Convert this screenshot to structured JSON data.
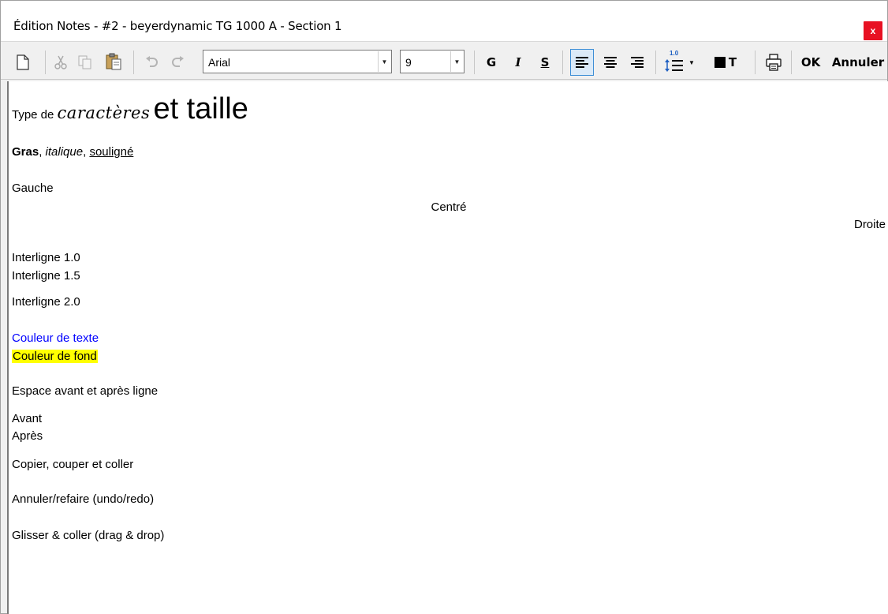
{
  "window": {
    "title": "Édition Notes - #2 - beyerdynamic TG 1000 A  -  Section 1",
    "close_label": "x"
  },
  "toolbar": {
    "font_name": "Arial",
    "font_size": "9",
    "bold_label": "G",
    "italic_label": "I",
    "underline_label": "S",
    "spacing_badge": "1.0",
    "color_label": "T",
    "ok_label": "OK",
    "cancel_label": "Annuler"
  },
  "editor": {
    "line1_small": "Type de",
    "line1_decor": "caractères",
    "line1_big": "et taille",
    "line2_bold": "Gras",
    "line2_sep1": ", ",
    "line2_italic": "italique",
    "line2_sep2": ", ",
    "line2_underline": "souligné",
    "left": "Gauche",
    "center": "Centré",
    "right": "Droite",
    "spacing1": "Interligne 1.0",
    "spacing15": "Interligne 1.5",
    "spacing2": "Interligne 2.0",
    "text_color": "Couleur de texte",
    "bg_color": "Couleur de fond",
    "space_title": "Espace avant et après ligne",
    "before": "Avant",
    "after": "Après",
    "clipboard": "Copier, couper et coller",
    "undo": "Annuler/refaire (undo/redo)",
    "dragdrop": "Glisser & coller (drag & drop)"
  },
  "colors": {
    "text_color": "#0000ff",
    "highlight": "#ffff00",
    "close": "#e81123",
    "accent": "#3c8ed6"
  }
}
